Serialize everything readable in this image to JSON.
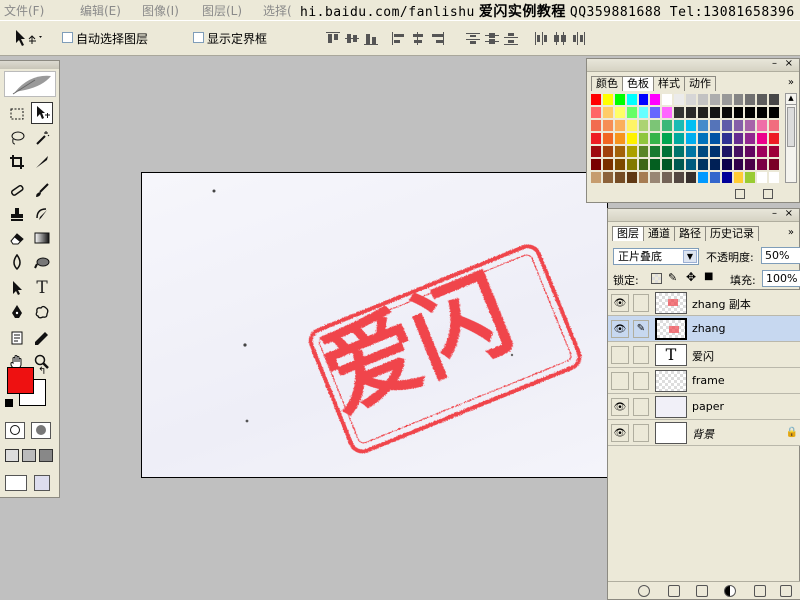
{
  "menubar": {
    "items": [
      {
        "label": "文件(F)"
      },
      {
        "label": "编辑(E)"
      },
      {
        "label": "图像(I)"
      },
      {
        "label": "图层(L)"
      },
      {
        "label": "选择("
      }
    ],
    "banner_url": "hi.baidu.com/fanlishu",
    "banner_title": "爱闪实例教程",
    "banner_qq": "QQ359881688 Tel:13081658396"
  },
  "options": {
    "auto_select_label": "自动选择图层",
    "show_bounds_label": "显示定界框"
  },
  "swatches_panel": {
    "tabs": [
      "颜色",
      "色板",
      "样式",
      "动作"
    ],
    "active_tab": "色板",
    "colors": [
      "#ff0000",
      "#ffff00",
      "#00ff00",
      "#00ffff",
      "#0000ff",
      "#ff00ff",
      "#ffffff",
      "#ebebeb",
      "#d6d6d6",
      "#c2c2c2",
      "#adadad",
      "#999999",
      "#858585",
      "#707070",
      "#5c5c5c",
      "#474747",
      "#ff6666",
      "#ffcc66",
      "#ffff66",
      "#66ff66",
      "#66ffff",
      "#6666ff",
      "#ff66ff",
      "#333333",
      "#292929",
      "#1f1f1f",
      "#141414",
      "#0a0a0a",
      "#000000",
      "#000000",
      "#000000",
      "#000000",
      "#f26c4f",
      "#f68e55",
      "#fbaf5c",
      "#fff467",
      "#acd372",
      "#7cc576",
      "#3bb878",
      "#1abbb4",
      "#00bff3",
      "#438ccb",
      "#5574b9",
      "#605ca8",
      "#855fa8",
      "#a763a9",
      "#ef6ea8",
      "#f16d7e",
      "#ee1d24",
      "#f16522",
      "#f7941d",
      "#fff200",
      "#8fc63d",
      "#37b44a",
      "#00a650",
      "#00a99e",
      "#00aeef",
      "#0072bc",
      "#0054a5",
      "#2f3192",
      "#652c91",
      "#91278f",
      "#ec008c",
      "#ed1c24",
      "#9e0b0f",
      "#a0410d",
      "#a3620a",
      "#aba000",
      "#598527",
      "#197b30",
      "#007236",
      "#00746b",
      "#0076a4",
      "#004a80",
      "#003370",
      "#1d1363",
      "#450e61",
      "#62055f",
      "#9e005c",
      "#9d0039",
      "#790000",
      "#7b3000",
      "#7c4900",
      "#827a00",
      "#3e6617",
      "#045f20",
      "#005824",
      "#005951",
      "#005b7e",
      "#003562",
      "#002056",
      "#0c004b",
      "#30004a",
      "#4b0048",
      "#7a0045",
      "#7a0026",
      "#c69c6e",
      "#8c6239",
      "#754c24",
      "#603813",
      "#a67c52",
      "#998675",
      "#736357",
      "#534741",
      "#362f2d",
      "#0099ff",
      "#3366cc",
      "#000099",
      "#ffcc33",
      "#99cc33",
      "#ffffff",
      "#ffffff"
    ]
  },
  "layers_panel": {
    "tabs": [
      "图层",
      "通道",
      "路径",
      "历史记录"
    ],
    "blend_mode": "正片叠底",
    "opacity_label": "不透明度:",
    "opacity_value": "50%",
    "lock_label": "锁定:",
    "fill_label": "填充:",
    "fill_value": "100%",
    "layers": [
      {
        "name": "zhang 副本",
        "visible": true,
        "selected": false,
        "type": "image"
      },
      {
        "name": "zhang",
        "visible": true,
        "selected": true,
        "type": "image"
      },
      {
        "name": "爱闪",
        "visible": false,
        "selected": false,
        "type": "text"
      },
      {
        "name": "frame",
        "visible": false,
        "selected": false,
        "type": "image"
      },
      {
        "name": "paper",
        "visible": true,
        "selected": false,
        "type": "image"
      },
      {
        "name": "背景",
        "visible": true,
        "selected": false,
        "type": "background"
      }
    ]
  },
  "canvas": {
    "stamp_text": "爱闪",
    "stamp_color": "#f0444c"
  },
  "tools_colors": {
    "foreground": "#ee1111",
    "background": "#ffffff"
  }
}
